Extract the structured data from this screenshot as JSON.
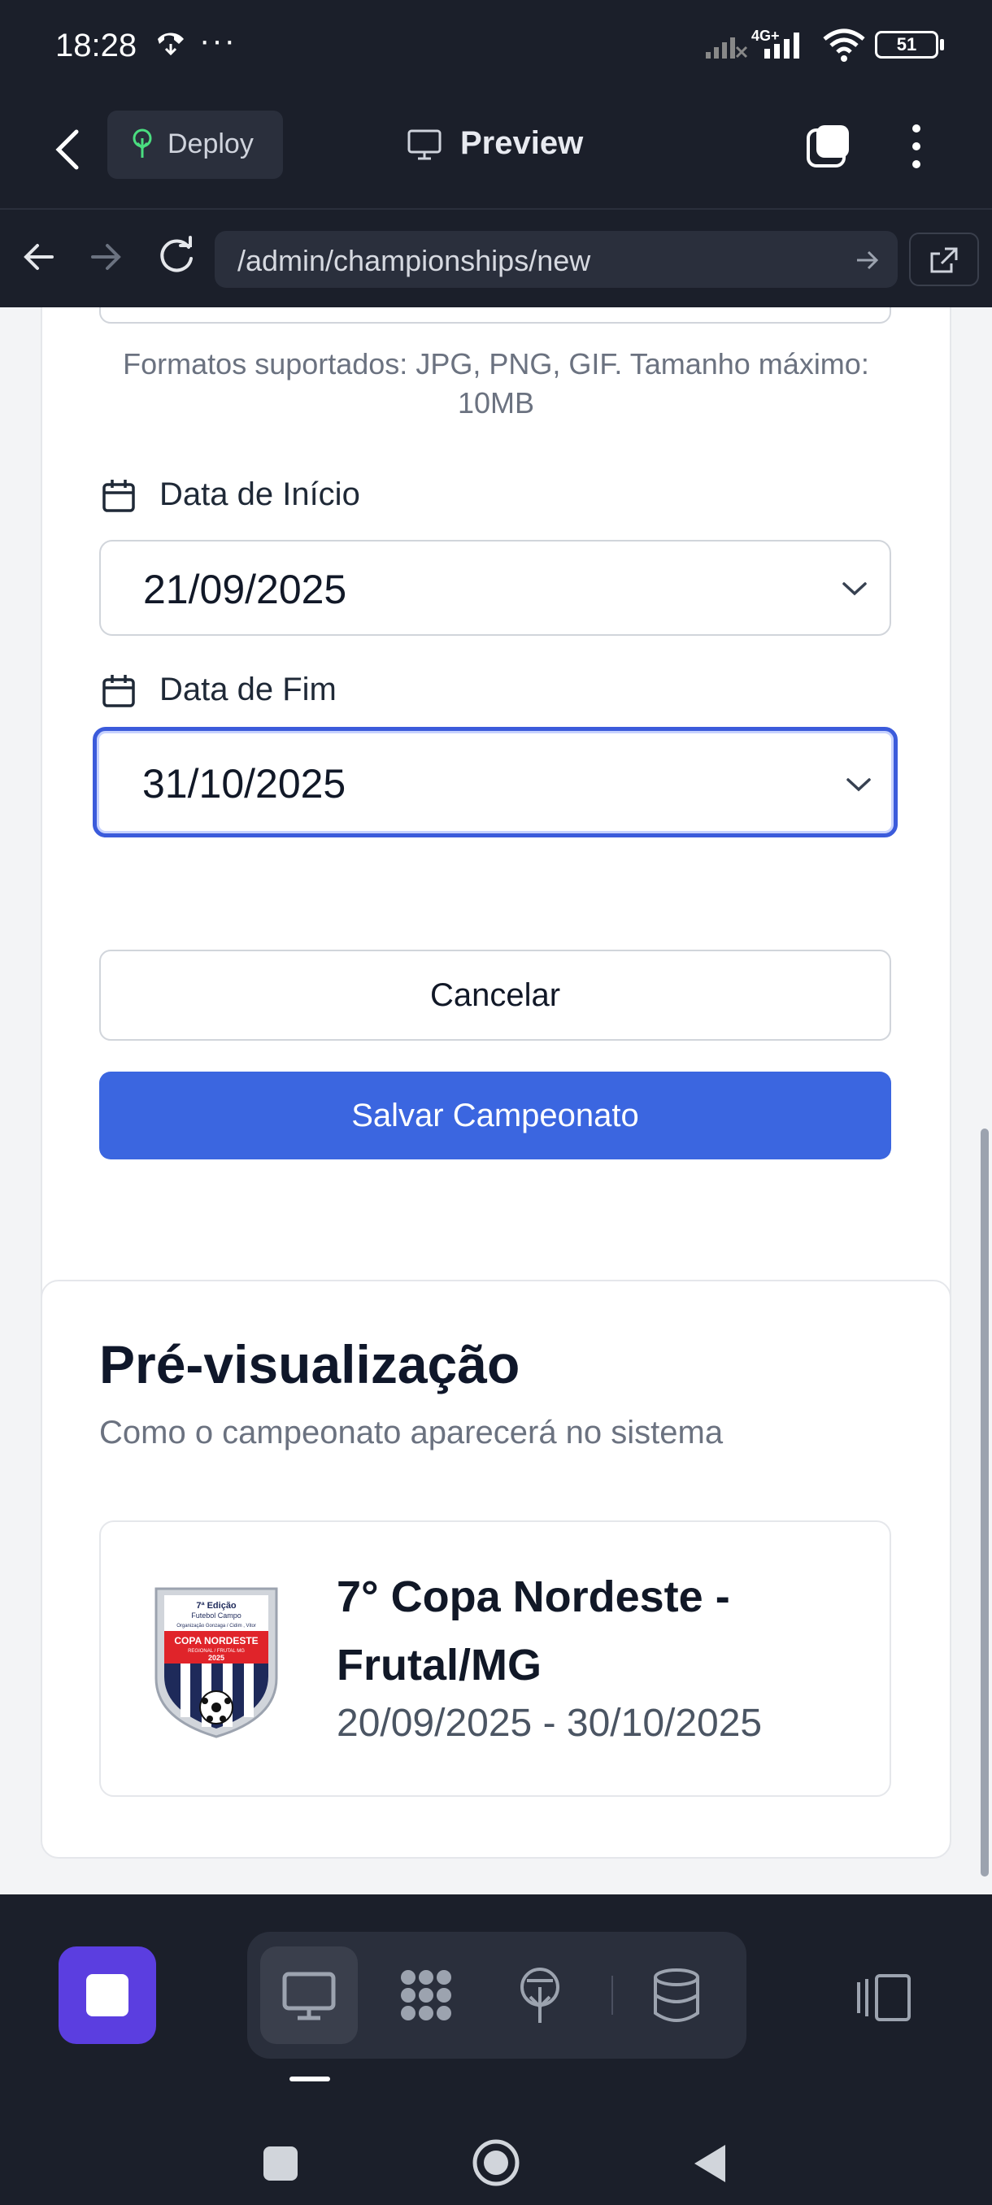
{
  "status_bar": {
    "time": "18:28",
    "dots": "···",
    "network": "4G+",
    "battery": "51"
  },
  "app_bar": {
    "deploy_label": "Deploy",
    "title": "Preview"
  },
  "url_bar": {
    "url": "/admin/championships/new"
  },
  "form": {
    "upload_hint": "Formatos suportados: JPG, PNG, GIF. Tamanho máximo: 10MB",
    "start_label": "Data de Início",
    "start_value": "21/09/2025",
    "end_label": "Data de Fim",
    "end_value": "31/10/2025",
    "cancel_label": "Cancelar",
    "save_label": "Salvar Campeonato"
  },
  "preview": {
    "title": "Pré-visualização",
    "subtitle": "Como o campeonato aparecerá no sistema",
    "championship_name": "7° Copa Nordeste - Frutal/MG",
    "dates": "20/09/2025 - 30/10/2025",
    "crest_text": {
      "edition": "7ª Edição",
      "sport": "Futebol Campo",
      "org": "Organização Gonzaga / Cidim , Vitor",
      "name": "COPA NORDESTE",
      "region": "REGIONAL / FRUTAL MG",
      "year": "2025"
    }
  },
  "colors": {
    "accent": "#3b66e0",
    "focus": "#3b5bdb",
    "stop": "#5b3ee0",
    "dark": "#1b1f2a"
  },
  "icons": {
    "back": "chevron-left-icon",
    "deploy": "tree-icon",
    "preview": "monitor-icon",
    "tabs": "tabs-icon",
    "menu": "kebab-icon",
    "calendar": "calendar-icon",
    "dropdown": "chevron-down-icon"
  }
}
